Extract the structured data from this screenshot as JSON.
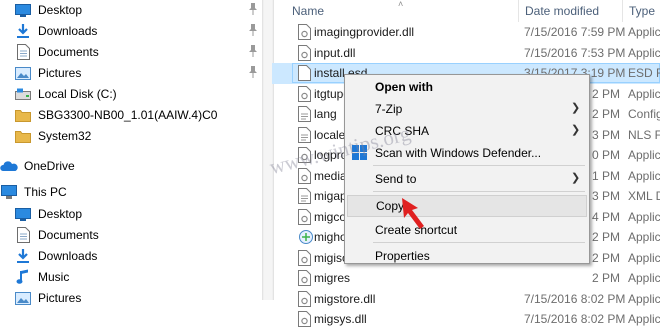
{
  "nav": {
    "items": [
      {
        "label": "Desktop",
        "icon": "desktop-folder-icon",
        "pinned": true
      },
      {
        "label": "Downloads",
        "icon": "downloads-icon",
        "pinned": true
      },
      {
        "label": "Documents",
        "icon": "documents-icon",
        "pinned": true
      },
      {
        "label": "Pictures",
        "icon": "pictures-icon",
        "pinned": true
      },
      {
        "label": "Local Disk (C:)",
        "icon": "local-disk-icon",
        "pinned": false
      },
      {
        "label": "SBG3300-NB00_1.01(AAIW.4)C0",
        "icon": "folder-icon",
        "pinned": false
      },
      {
        "label": "System32",
        "icon": "folder-icon",
        "pinned": false
      },
      {
        "label": "OneDrive",
        "icon": "onedrive-icon",
        "pinned": false
      },
      {
        "label": "This PC",
        "icon": "this-pc-icon",
        "pinned": false
      },
      {
        "label": "Desktop",
        "icon": "desktop-folder-icon",
        "pinned": false
      },
      {
        "label": "Documents",
        "icon": "documents-icon",
        "pinned": false
      },
      {
        "label": "Downloads",
        "icon": "downloads-icon",
        "pinned": false
      },
      {
        "label": "Music",
        "icon": "music-icon",
        "pinned": false
      },
      {
        "label": "Pictures",
        "icon": "pictures-icon",
        "pinned": false
      }
    ],
    "pin_glyph": "📌"
  },
  "list": {
    "columns": {
      "name": "Name",
      "date": "Date modified",
      "type": "Type"
    },
    "rows": [
      {
        "name": "imagingprovider.dll",
        "date": "7/15/2016 7:59 PM",
        "type": "Applic"
      },
      {
        "name": "input.dll",
        "date": "7/15/2016 7:53 PM",
        "type": "Applic"
      },
      {
        "name": "install.esd",
        "date": "3/15/2017 3:19 PM",
        "type": "ESD Fi"
      },
      {
        "name": "itgtupg",
        "date": "2 PM",
        "type": "Applic"
      },
      {
        "name": "lang",
        "date": "2 PM",
        "type": "Config"
      },
      {
        "name": "locale.n",
        "date": "3 PM",
        "type": "NLS Fi"
      },
      {
        "name": "logpro",
        "date": "0 PM",
        "type": "Applic"
      },
      {
        "name": "medias",
        "date": "1 PM",
        "type": "Applic"
      },
      {
        "name": "migapp",
        "date": "3 PM",
        "type": "XML D"
      },
      {
        "name": "migcore",
        "date": "4 PM",
        "type": "Applic"
      },
      {
        "name": "mighos",
        "date": "2 PM",
        "type": "Applic"
      },
      {
        "name": "migisol",
        "date": "2 PM",
        "type": "Applic"
      },
      {
        "name": "migres",
        "date": "2 PM",
        "type": "Applic"
      },
      {
        "name": "migstore.dll",
        "date": "7/15/2016 8:02 PM",
        "type": "Applic"
      },
      {
        "name": "migsys.dll",
        "date": "7/15/2016 8:02 PM",
        "type": "Applic"
      }
    ]
  },
  "context_menu": {
    "open_with": "Open with",
    "zip": "7-Zip",
    "crc": "CRC SHA",
    "defender": "Scan with Windows Defender...",
    "send_to": "Send to",
    "copy": "Copy",
    "shortcut": "Create shortcut",
    "properties": "Properties",
    "arrow": "❯"
  },
  "watermark": "www.wintips.org",
  "colors": {
    "selection": "#cce8ff",
    "accent": "#0078d7",
    "folder": "#e8b84a"
  }
}
